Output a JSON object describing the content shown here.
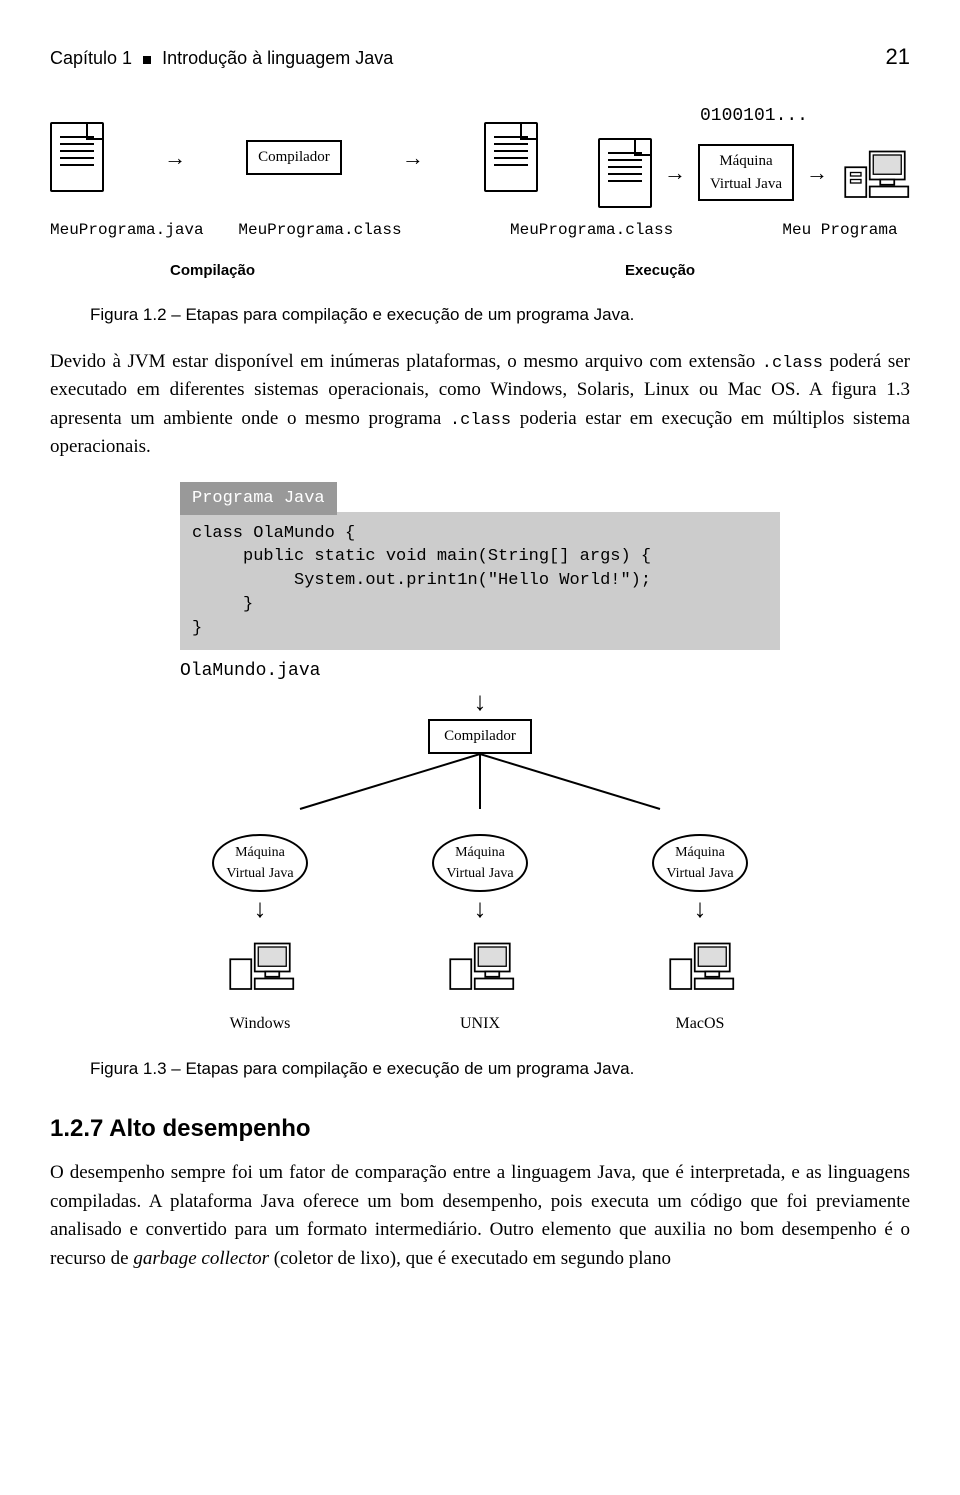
{
  "header": {
    "chapter_label": "Capítulo 1",
    "chapter_title": "Introdução à linguagem Java",
    "page_number": "21"
  },
  "figure1": {
    "binary_label": "0100101...",
    "compiler_label": "Compilador",
    "jvm_line1": "Máquina",
    "jvm_line2": "Virtual Java",
    "file_source": "MeuPrograma.java",
    "file_class1": "MeuPrograma.class",
    "file_class2": "MeuPrograma.class",
    "program_label": "Meu Programa",
    "compile_label": "Compilação",
    "execute_label": "Execução",
    "caption": "Figura 1.2 – Etapas para compilação e execução de um programa Java."
  },
  "paragraph1": {
    "part1": "Devido à JVM estar disponível em inúmeras plataformas, o mesmo arquivo com extensão ",
    "mono1": ".class",
    "part2": " poderá ser executado em diferentes sistemas operacionais, como Windows, Solaris, Linux ou Mac OS. A figura 1.3 apresenta um ambiente onde o mesmo programa ",
    "mono2": ".class",
    "part3": " poderia estar em execução em múltiplos sistema operacionais."
  },
  "figure2": {
    "program_tab": "Programa Java",
    "code_line1": "class OlaMundo {",
    "code_line2": "     public static void main(String[] args) {",
    "code_line3": "          System.out.print1n(\"Hello World!\");",
    "code_line4": "     }",
    "code_line5": "}",
    "file_name": "OlaMundo.java",
    "compiler_label": "Compilador",
    "jvm_line1": "Máquina",
    "jvm_line2": "Virtual Java",
    "os1": "Windows",
    "os2": "UNIX",
    "os3": "MacOS",
    "caption": "Figura 1.3 – Etapas para compilação e execução de um programa Java."
  },
  "section": {
    "heading": "1.2.7 Alto desempenho",
    "body_part1": "O desempenho sempre foi um fator de comparação entre a linguagem Java, que é interpretada, e as linguagens compiladas. A plataforma Java oferece um bom desempenho, pois executa um código que foi previamente analisado e convertido para um formato intermediário. Outro elemento que auxilia no bom desempenho é o recurso de ",
    "body_italic": "garbage collector",
    "body_part2": " (coletor de lixo), que é executado em segundo plano"
  }
}
